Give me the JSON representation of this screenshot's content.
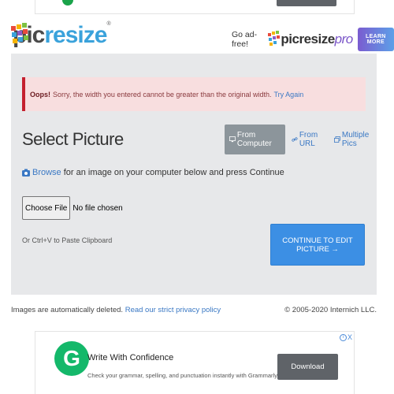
{
  "top_ad": {},
  "header": {
    "logo": {
      "text_pic": "pic",
      "text_resize": "resize",
      "mark": "®"
    },
    "promo": {
      "label": "Go ad-free!",
      "pro_logo_pic": "picresize",
      "pro_logo_pro": "pro",
      "learn_more": "LEARN MORE"
    }
  },
  "alert": {
    "title": "Oops!",
    "message": "Sorry, the width you entered cannot be greater than the original width.",
    "link": "Try Again"
  },
  "select": {
    "title": "Select Picture",
    "tabs": [
      {
        "label": "From Computer",
        "icon": "monitor-icon",
        "active": true
      },
      {
        "label": "From URL",
        "icon": "link-icon",
        "active": false
      },
      {
        "label": "Multiple Pics",
        "icon": "images-icon",
        "active": false
      }
    ],
    "browse_link": "Browse",
    "browse_text": "for an image on your computer below and press Continue",
    "choose_file": "Choose File",
    "no_file": "No file chosen",
    "paste_hint": "Or Ctrl+V to Paste Clipboard",
    "continue": "CONTINUE TO EDIT PICTURE →"
  },
  "footer": {
    "note": "Images are automatically deleted.",
    "privacy_link": "Read our strict privacy policy",
    "copyright": "© 2005-2020 Internich LLC."
  },
  "ad": {
    "close_letter": "X",
    "logo_letter": "G",
    "title": "Write With Confidence",
    "description": "Check your grammar, spelling, and punctuation instantly with Grammarly Grammarly",
    "button": "Download"
  },
  "colors": {
    "accent": "#3c8fe4",
    "alert_bg": "#f8dedf",
    "alert_border": "#c4202f",
    "panel_bg": "#e7e8ea",
    "grammarly": "#14b86a"
  }
}
